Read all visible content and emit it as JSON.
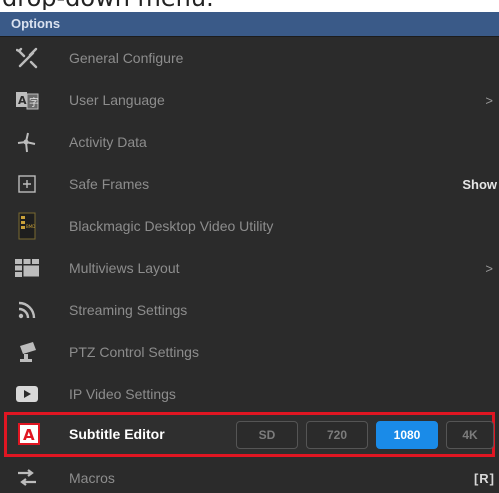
{
  "caption": "drop-down menu.",
  "window": {
    "title": "Options"
  },
  "items": [
    {
      "label": "General Configure",
      "icon": "tools-icon"
    },
    {
      "label": "User Language",
      "icon": "language-icon",
      "arrow": ">"
    },
    {
      "label": "Activity Data",
      "icon": "activity-icon"
    },
    {
      "label": "Safe Frames",
      "icon": "safe-frames-icon",
      "value": "Show"
    },
    {
      "label": "Blackmagic Desktop Video Utility",
      "icon": "blackmagic-icon"
    },
    {
      "label": "Multiviews Layout",
      "icon": "multiview-icon",
      "arrow": ">"
    },
    {
      "label": "Streaming Settings",
      "icon": "streaming-icon"
    },
    {
      "label": "PTZ Control Settings",
      "icon": "ptz-camera-icon"
    },
    {
      "label": "IP Video Settings",
      "icon": "ip-video-icon"
    }
  ],
  "subtitle_editor": {
    "label": "Subtitle Editor",
    "icon": "subtitle-editor-icon",
    "resolutions": [
      "SD",
      "720",
      "1080",
      "4K"
    ],
    "selected": "1080"
  },
  "macros": {
    "label": "Macros",
    "hotkey": "[R]",
    "icon": "macros-icon"
  },
  "colors": {
    "titlebar": "#3a5a88",
    "highlight_border": "#e01622",
    "active_button": "#1a8be8"
  }
}
